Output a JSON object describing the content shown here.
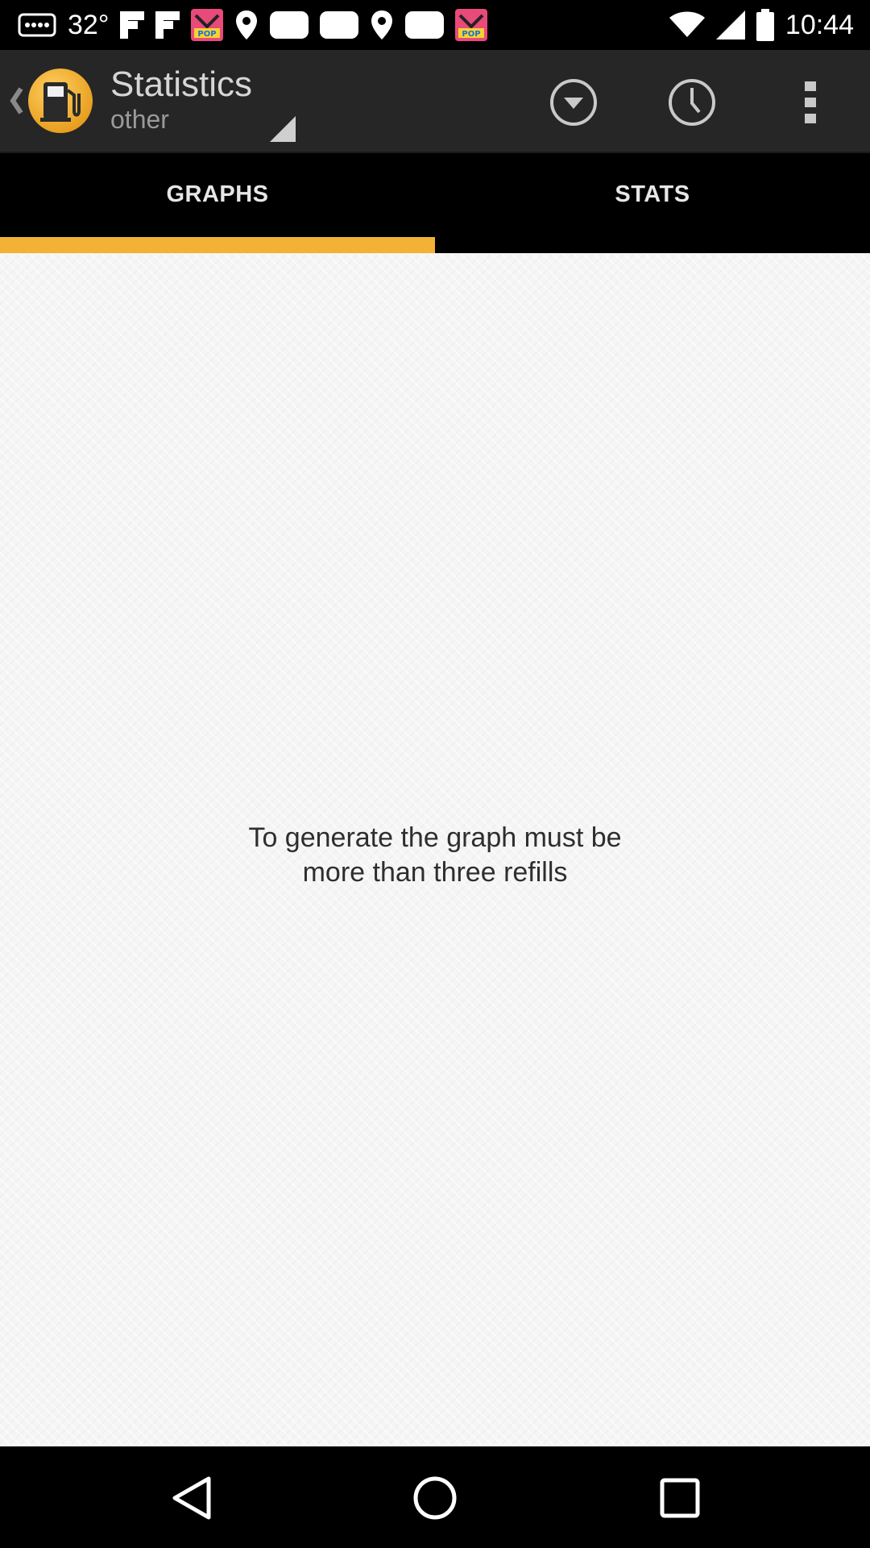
{
  "status_bar": {
    "temperature": "32°",
    "time": "10:44",
    "icons": [
      "bbm-icon",
      "flipboard-icon",
      "flipboard-icon",
      "pop-app-icon",
      "location-pin-icon",
      "message-icon",
      "message-icon",
      "location-pin-icon",
      "message-icon",
      "pop-app-icon",
      "wifi-icon",
      "signal-icon",
      "battery-icon"
    ]
  },
  "action_bar": {
    "title": "Statistics",
    "subtitle": "other",
    "app_icon": "fuel-pump-icon",
    "actions": [
      "dropdown-circle-icon",
      "clock-icon",
      "overflow-menu-icon"
    ]
  },
  "tabs": [
    {
      "label": "GRAPHS",
      "selected": true
    },
    {
      "label": "STATS",
      "selected": false
    }
  ],
  "content": {
    "message": "To generate the graph must be\nmore than three refills"
  },
  "nav_bar": {
    "buttons": [
      "back-icon",
      "home-icon",
      "recents-icon"
    ]
  },
  "colors": {
    "accent": "#f3b136",
    "action_bar": "#262626",
    "content_bg": "#f5f5f5"
  }
}
